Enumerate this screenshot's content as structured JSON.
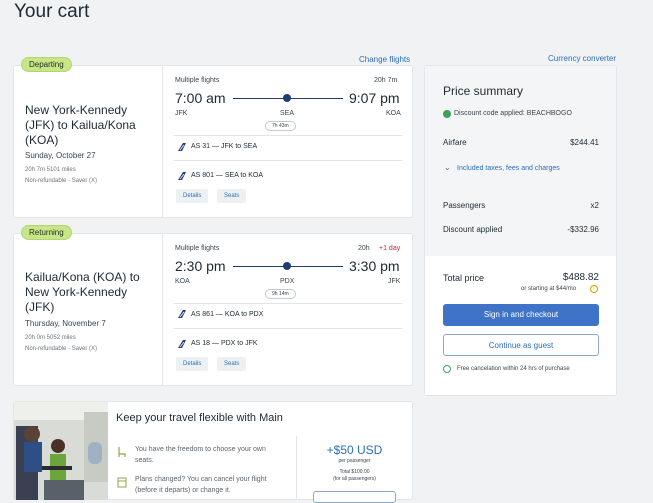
{
  "page": {
    "title": "Your cart"
  },
  "links": {
    "change_flights": "Change flights",
    "currency_converter": "Currency converter"
  },
  "departing": {
    "badge": "Departing",
    "route": [
      "New York-Kennedy",
      "(JFK) to Kailua/Kona",
      "(KOA)"
    ],
    "date": "Sunday, October 27",
    "duration_miles": "20h 7m   5101 miles",
    "fare": "Non-refundable · Saver (X)",
    "flights_label": "Multiple flights",
    "total_duration": "20h 7m",
    "depart_time": "7:00 am",
    "arrive_time": "9:07 pm",
    "origin": "JFK",
    "stop": "SEA",
    "dest": "KOA",
    "layover": "7h 43m",
    "legs": [
      "AS 31 — JFK to SEA",
      "AS 801 — SEA to KOA"
    ],
    "details": "Details",
    "seats": "Seats"
  },
  "returning": {
    "badge": "Returning",
    "route": [
      "Kailua/Kona (KOA) to",
      "New York-Kennedy",
      "(JFK)"
    ],
    "date": "Thursday, November 7",
    "duration_miles": "20h 0m   5052 miles",
    "fare": "Non-refundable · Saver (X)",
    "flights_label": "Multiple flights",
    "total_duration": "20h",
    "plus_day": "+1 day",
    "depart_time": "2:30 pm",
    "arrive_time": "3:30 pm",
    "origin": "KOA",
    "stop": "PDX",
    "dest": "JFK",
    "layover": "9h 14m",
    "legs": [
      "AS 861 — KOA to PDX",
      "AS 18 — PDX to JFK"
    ],
    "details": "Details",
    "seats": "Seats"
  },
  "summary": {
    "title": "Price summary",
    "discount_code": "Discount code applied: BEACHBOGO",
    "airfare_label": "Airfare",
    "airfare_value": "$244.41",
    "taxes_link": "Included taxes, fees and charges",
    "passengers_label": "Passengers",
    "passengers_value": "x2",
    "discount_label": "Discount applied",
    "discount_value": "-$332.96",
    "total_label": "Total price",
    "total_value": "$488.82",
    "monthly": "or starting at $44/mo",
    "signin_btn": "Sign in and checkout",
    "guest_btn": "Continue as guest",
    "cancel_note": "Free cancelation within 24 hrs of purchase"
  },
  "upsell": {
    "title": "Keep your travel flexible with Main",
    "bullet1": [
      "You have the freedom to choose your own",
      "seats."
    ],
    "bullet2": [
      "Plans changed? You can cancel your flight",
      "(before it departs) or change it."
    ],
    "price": "+$50 USD",
    "per": "per passenger",
    "total": "Total $100.00",
    "total_sub": "(for all passengers)"
  },
  "colors": {
    "accent": "#3f73c8",
    "badge": "#c7e68a",
    "discount_green": "#3aa35c",
    "plus_day": "#c0243a"
  }
}
